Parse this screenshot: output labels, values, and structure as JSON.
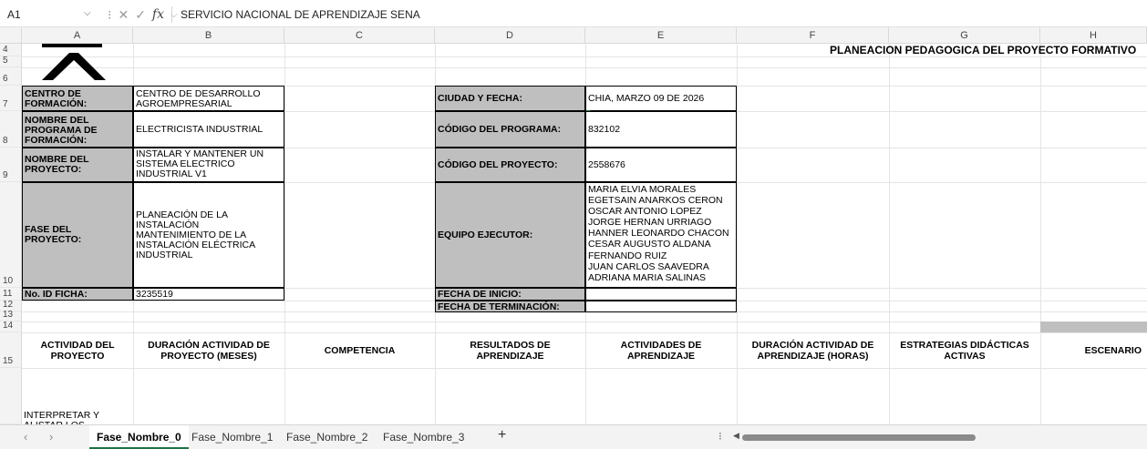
{
  "formula_bar": {
    "name_box": "A1",
    "formula": "SERVICIO NACIONAL DE APRENDIZAJE SENA"
  },
  "columns": [
    "A",
    "B",
    "C",
    "D",
    "E",
    "F",
    "G",
    "H"
  ],
  "rows": [
    "4",
    "5",
    "6",
    "7",
    "8",
    "9",
    "10",
    "11",
    "12",
    "13",
    "14",
    "15"
  ],
  "sheet": {
    "title": "PLANEACIÓN PEDAGÓGICA DEL PROYECTO FORMATIVO",
    "centro_label": "CENTRO DE FORMACIÓN:",
    "centro_value": "CENTRO DE DESARROLLO AGROEMPRESARIAL",
    "programa_label": "NOMBRE DEL PROGRAMA DE FORMACIÓN:",
    "programa_value": "ELECTRICISTA INDUSTRIAL",
    "proyecto_label": "NOMBRE DEL PROYECTO:",
    "proyecto_value": "INSTALAR Y MANTENER UN SISTEMA ELECTRICO INDUSTRIAL V1",
    "fase_label": "FASE DEL PROYECTO:",
    "fase_value": " PLANEACIÓN DE LA INSTALACIÓN MANTENIMIENTO DE LA INSTALACIÓN ELÉCTRICA INDUSTRIAL",
    "ficha_label": "No. ID FICHA:",
    "ficha_value": "3235519",
    "ciudad_label": "CIUDAD Y FECHA:",
    "ciudad_value": "CHIA, MARZO 09 DE 2026",
    "codprog_label": "CÓDIGO DEL PROGRAMA:",
    "codprog_value": "832102",
    "codproy_label": "CÓDIGO DEL PROYECTO:",
    "codproy_value": "2558676",
    "equipo_label": "EQUIPO EJECUTOR:",
    "equipo_members": [
      "MARIA ELVIA MORALES",
      "EGETSAIN ANARKOS CERON",
      "OSCAR ANTONIO LOPEZ",
      "JORGE HERNAN URRIAGO",
      "HANNER LEONARDO CHACON",
      "CESAR AUGUSTO ALDANA",
      "FERNANDO RUIZ",
      "JUAN CARLOS SAAVEDRA",
      "ADRIANA MARIA SALINAS"
    ],
    "inicio_label": "FECHA DE INICIO:",
    "terminacion_label": "FECHA DE TERMINACIÓN:",
    "table_headers": [
      "ACTIVIDAD DEL PROYECTO",
      "DURACIÓN ACTIVIDAD DE PROYECTO (MESES)",
      "COMPETENCIA",
      "RESULTADOS DE APRENDIZAJE",
      "ACTIVIDADES DE APRENDIZAJE",
      "DURACIÓN ACTIVIDAD DE APRENDIZAJE (HORAS)",
      "ESTRATEGIAS DIDÁCTICAS ACTIVAS",
      "ESCENARIO"
    ],
    "first_activity": "INTERPRETAR Y ALISTAR LOS INSUMOS"
  },
  "tabs": [
    "Fase_Nombre_0",
    "Fase_Nombre_1",
    "Fase_Nombre_2",
    "Fase_Nombre_3"
  ],
  "active_tab": "Fase_Nombre_0",
  "colors": {
    "label_fill": "#bfbfbf",
    "tab_accent": "#1e7145",
    "header_fill": "#f3f3f3"
  }
}
